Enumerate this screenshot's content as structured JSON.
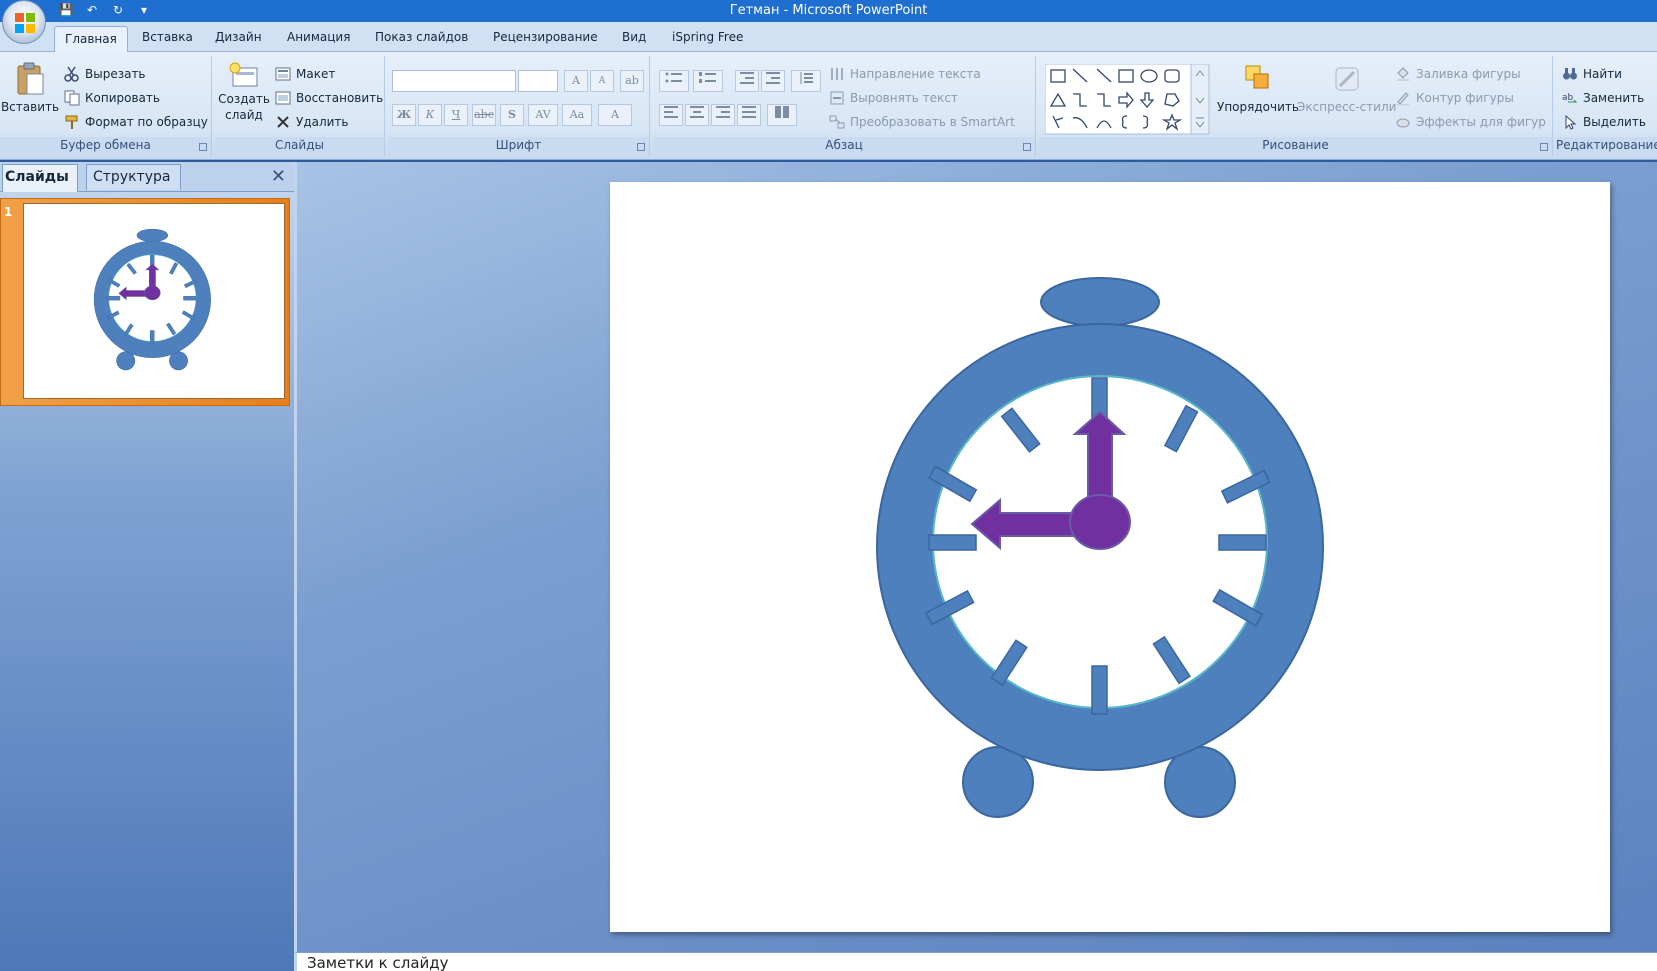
{
  "window": {
    "title": "Гетман - Microsoft PowerPoint"
  },
  "qat": {
    "save": "💾",
    "undo": "↶",
    "redo": "↻",
    "more": "▾"
  },
  "tabs": [
    {
      "label": "Главная"
    },
    {
      "label": "Вставка"
    },
    {
      "label": "Дизайн"
    },
    {
      "label": "Анимация"
    },
    {
      "label": "Показ слайдов"
    },
    {
      "label": "Рецензирование"
    },
    {
      "label": "Вид"
    },
    {
      "label": "iSpring Free"
    }
  ],
  "ribbon": {
    "clipboard": {
      "label": "Буфер обмена",
      "paste": "Вставить",
      "cut": "Вырезать",
      "copy": "Копировать",
      "format_painter": "Формат по образцу"
    },
    "slides": {
      "label": "Слайды",
      "new_slide_1": "Создать",
      "new_slide_2": "слайд",
      "layout": "Макет",
      "reset": "Восстановить",
      "delete": "Удалить"
    },
    "font": {
      "label": "Шрифт",
      "grow": "A",
      "shrink": "A",
      "clear": "ab",
      "bold": "Ж",
      "italic": "К",
      "underline": "Ч",
      "strike": "abc",
      "shadow": "S",
      "spacing": "AV",
      "case": "Aa",
      "color": "A"
    },
    "paragraph": {
      "label": "Абзац",
      "text_direction": "Направление текста",
      "align_text": "Выровнять текст",
      "smartart": "Преобразовать в SmartArt"
    },
    "drawing": {
      "label": "Рисование",
      "arrange": "Упорядочить",
      "quick_styles": "Экспресс-стили",
      "shape_fill": "Заливка фигуры",
      "shape_outline": "Контур фигуры",
      "shape_effects": "Эффекты для фигур"
    },
    "editing": {
      "label": "Редактирование",
      "find": "Найти",
      "replace": "Заменить",
      "select": "Выделить"
    }
  },
  "leftpane": {
    "tab_slides": "Слайды",
    "tab_outline": "Структура",
    "close": "✕",
    "slide_number": "1"
  },
  "notes": {
    "placeholder": "Заметки к слайду"
  },
  "colors": {
    "clock_blue": "#4e80bd",
    "clock_border": "#3b679e",
    "hands_purple": "#7030a0",
    "face_border": "#58b8c8"
  }
}
